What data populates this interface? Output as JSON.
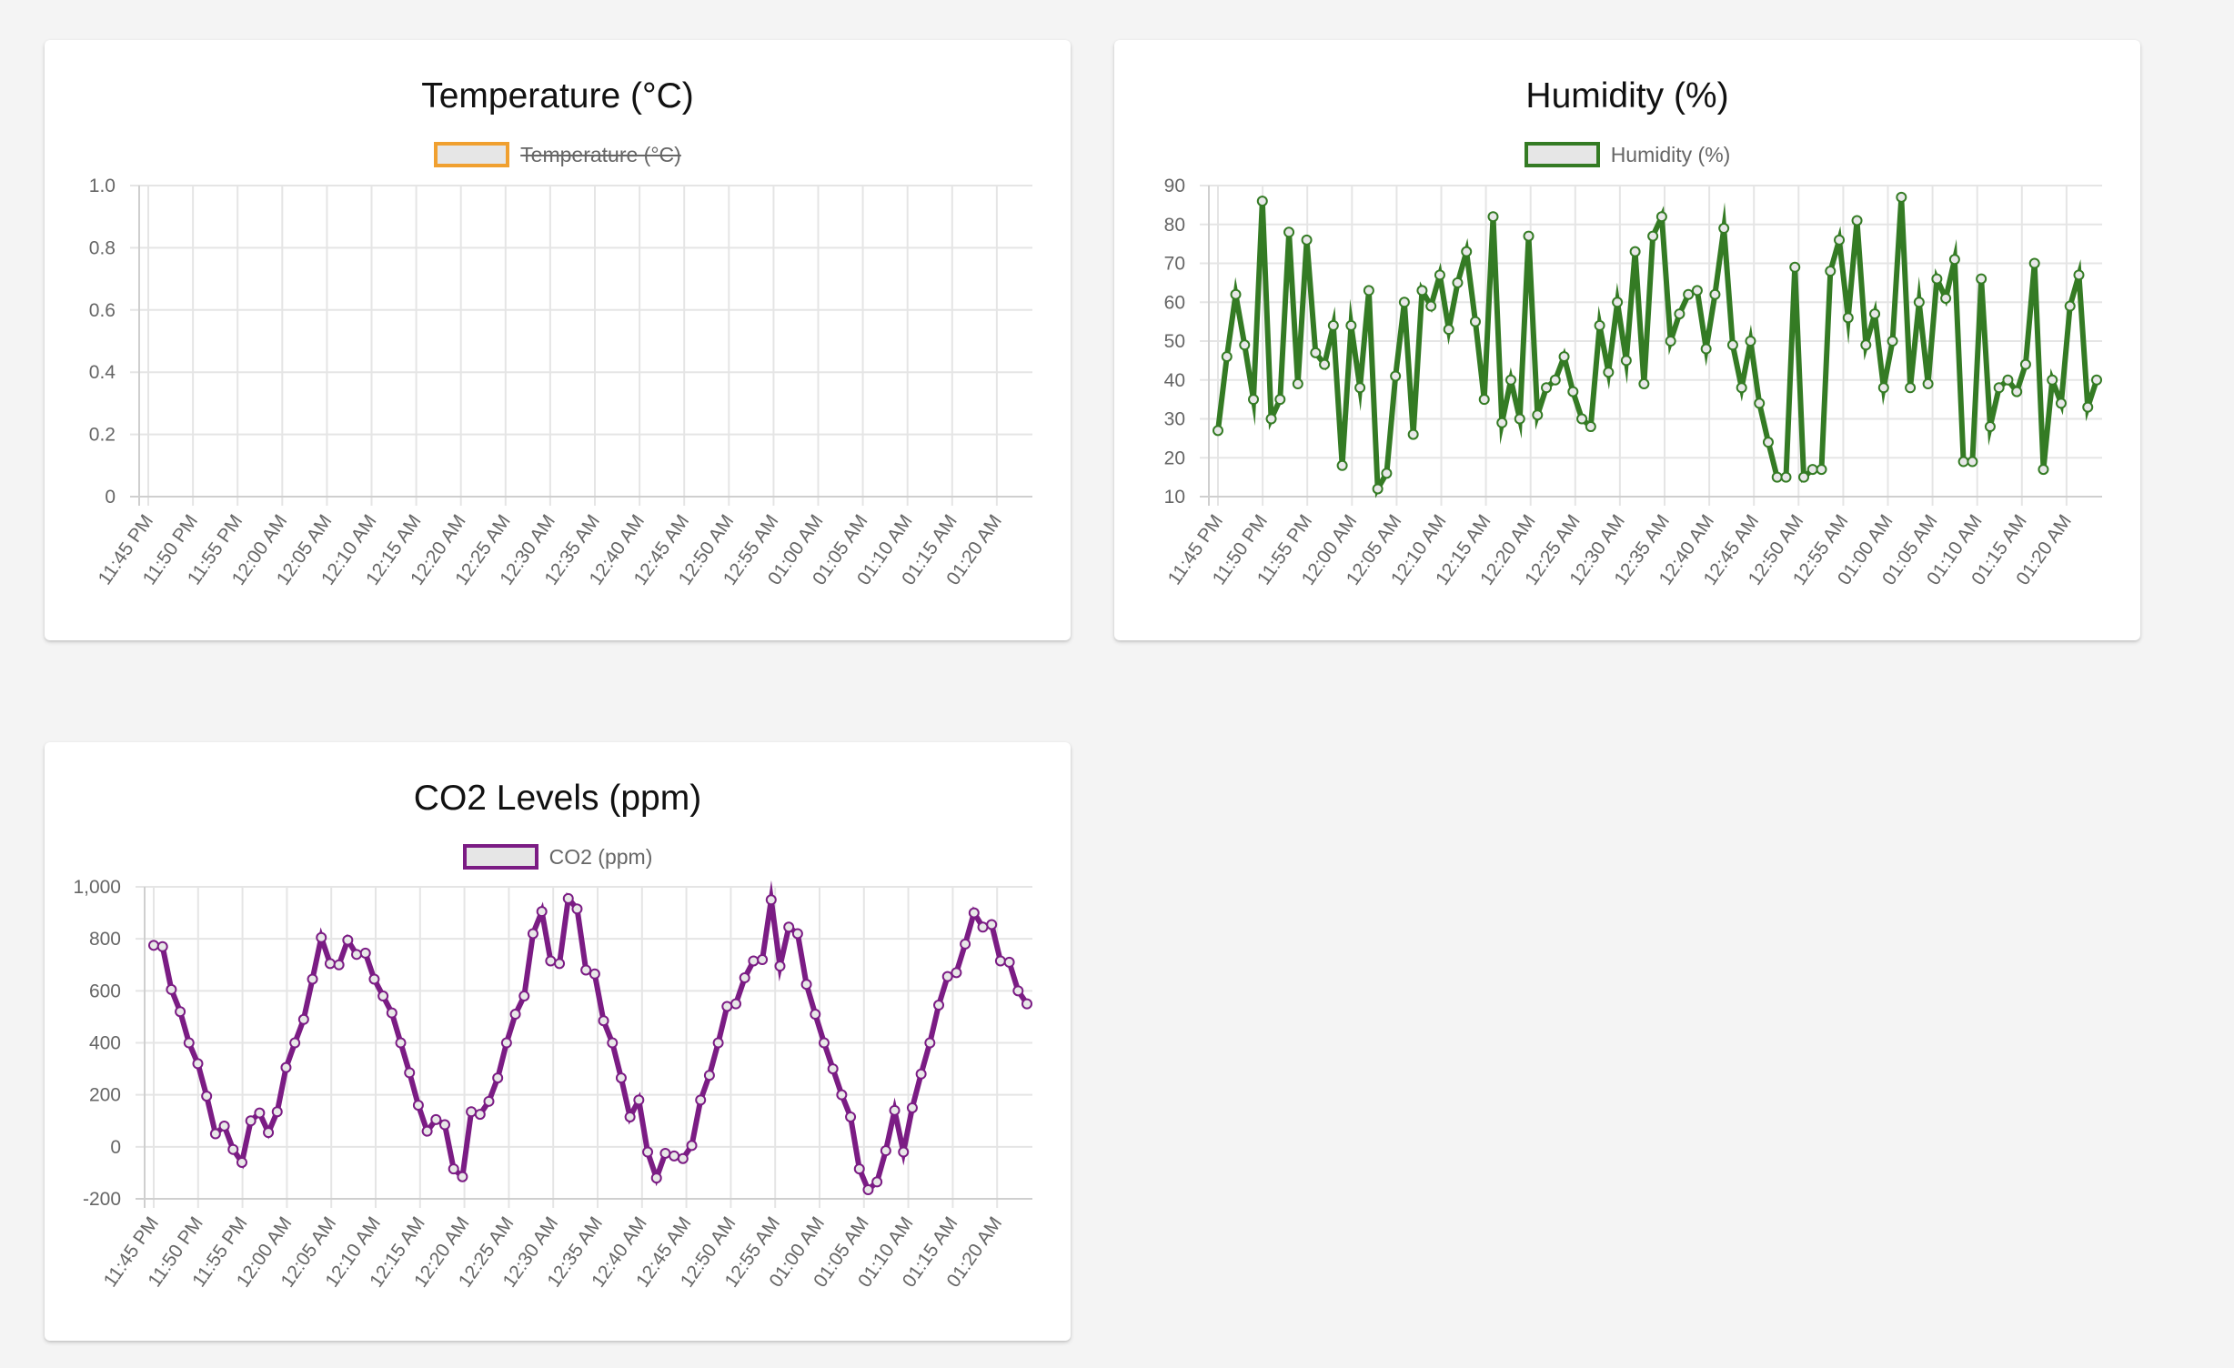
{
  "chart_data": [
    {
      "type": "line",
      "title": "Temperature (°C)",
      "color": "#f0a030",
      "legend_position": "top",
      "series": [
        {
          "name": "Temperature (°C)",
          "hidden": true,
          "values": []
        }
      ],
      "x_labels": [
        "11:45 PM",
        "11:50 PM",
        "11:55 PM",
        "12:00 AM",
        "12:05 AM",
        "12:10 AM",
        "12:15 AM",
        "12:20 AM",
        "12:25 AM",
        "12:30 AM",
        "12:35 AM",
        "12:40 AM",
        "12:45 AM",
        "12:50 AM",
        "12:55 AM",
        "01:00 AM",
        "01:05 AM",
        "01:10 AM",
        "01:15 AM",
        "01:20 AM"
      ],
      "y_ticks": [
        "0",
        "0.2",
        "0.4",
        "0.6",
        "0.8",
        "1.0"
      ],
      "ylim": [
        0,
        1
      ],
      "grid": true
    },
    {
      "type": "line",
      "title": "Humidity (%)",
      "color": "#347b24",
      "legend_position": "top",
      "series": [
        {
          "name": "Humidity (%)",
          "hidden": false,
          "values": [
            27,
            46,
            62,
            49,
            35,
            86,
            30,
            35,
            78,
            39,
            76,
            47,
            44,
            54,
            18,
            54,
            38,
            63,
            12,
            16,
            41,
            60,
            26,
            63,
            59,
            67,
            53,
            65,
            73,
            55,
            35,
            82,
            29,
            40,
            30,
            77,
            31,
            38,
            40,
            46,
            37,
            30,
            28,
            54,
            42,
            60,
            45,
            73,
            39,
            77,
            82,
            50,
            57,
            62,
            63,
            48,
            62,
            79,
            49,
            38,
            50,
            34,
            24,
            15,
            15,
            69,
            15,
            17,
            17,
            68,
            76,
            56,
            81,
            49,
            57,
            38,
            50,
            87,
            38,
            60,
            39,
            66,
            61,
            71,
            19,
            19,
            66,
            28,
            38,
            40,
            37,
            44,
            70,
            17,
            40,
            34,
            59,
            67,
            33,
            40
          ]
        }
      ],
      "x_labels": [
        "11:45 PM",
        "11:50 PM",
        "11:55 PM",
        "12:00 AM",
        "12:05 AM",
        "12:10 AM",
        "12:15 AM",
        "12:20 AM",
        "12:25 AM",
        "12:30 AM",
        "12:35 AM",
        "12:40 AM",
        "12:45 AM",
        "12:50 AM",
        "12:55 AM",
        "01:00 AM",
        "01:05 AM",
        "01:10 AM",
        "01:15 AM",
        "01:20 AM"
      ],
      "y_ticks": [
        "10",
        "20",
        "30",
        "40",
        "50",
        "60",
        "70",
        "80",
        "90"
      ],
      "ylim": [
        10,
        90
      ],
      "grid": true
    },
    {
      "type": "line",
      "title": "CO2 Levels (ppm)",
      "color": "#7b1c84",
      "legend_position": "top",
      "series": [
        {
          "name": "CO2 (ppm)",
          "hidden": false,
          "values": [
            775,
            770,
            605,
            520,
            400,
            320,
            195,
            50,
            80,
            -10,
            -60,
            100,
            130,
            55,
            135,
            305,
            400,
            490,
            645,
            805,
            705,
            700,
            795,
            740,
            745,
            645,
            580,
            515,
            400,
            285,
            160,
            60,
            105,
            85,
            -85,
            -115,
            135,
            125,
            175,
            265,
            400,
            510,
            580,
            820,
            905,
            715,
            705,
            955,
            915,
            680,
            665,
            485,
            400,
            265,
            115,
            180,
            -20,
            -120,
            -25,
            -35,
            -45,
            5,
            180,
            275,
            400,
            540,
            550,
            650,
            715,
            720,
            950,
            695,
            845,
            820,
            625,
            510,
            400,
            300,
            200,
            115,
            -85,
            -165,
            -135,
            -15,
            140,
            -20,
            150,
            280,
            400,
            545,
            655,
            670,
            780,
            900,
            845,
            855,
            715,
            710,
            600,
            550
          ]
        }
      ],
      "x_labels": [
        "11:45 PM",
        "11:50 PM",
        "11:55 PM",
        "12:00 AM",
        "12:05 AM",
        "12:10 AM",
        "12:15 AM",
        "12:20 AM",
        "12:25 AM",
        "12:30 AM",
        "12:35 AM",
        "12:40 AM",
        "12:45 AM",
        "12:50 AM",
        "12:55 AM",
        "01:00 AM",
        "01:05 AM",
        "01:10 AM",
        "01:15 AM",
        "01:20 AM"
      ],
      "y_ticks": [
        "-200",
        "0",
        "200",
        "400",
        "600",
        "800",
        "1,000"
      ],
      "ylim": [
        -200,
        1000
      ],
      "grid": true
    }
  ]
}
